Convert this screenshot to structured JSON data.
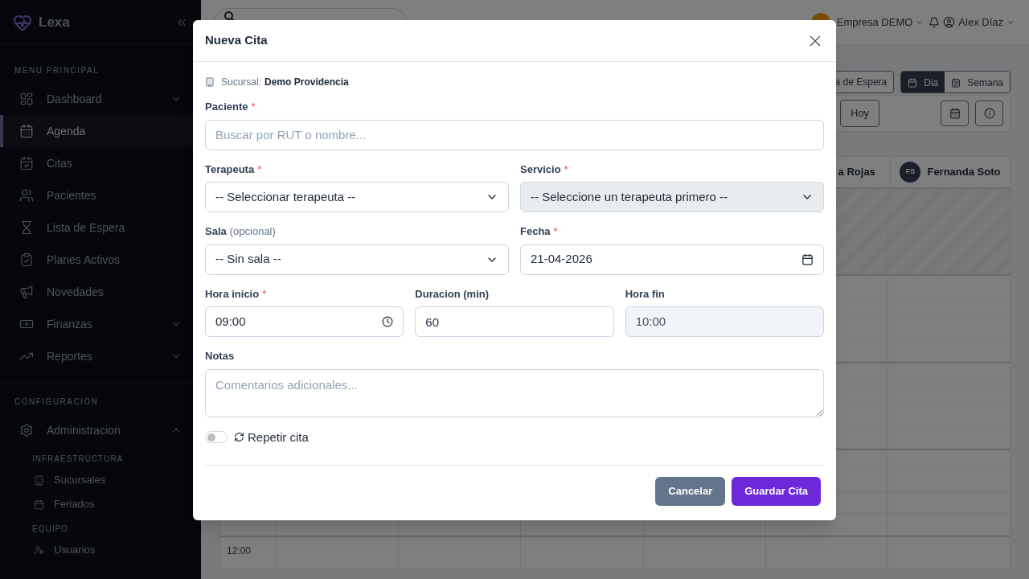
{
  "sidebar": {
    "brand": "Lexa",
    "sections": [
      {
        "title": "MENU PRINCIPAL",
        "items": [
          {
            "label": "Dashboard",
            "selected": false,
            "expanded": false
          },
          {
            "label": "Agenda",
            "selected": true
          },
          {
            "label": "Citas",
            "selected": false
          },
          {
            "label": "Pacientes",
            "selected": false
          },
          {
            "label": "Lista de Espera",
            "selected": false
          },
          {
            "label": "Planes Activos",
            "selected": false
          },
          {
            "label": "Novedades",
            "selected": false
          },
          {
            "label": "Finanzas",
            "selected": false,
            "expanded": false
          },
          {
            "label": "Reportes",
            "selected": false,
            "expanded": false
          }
        ]
      },
      {
        "title": "CONFIGURACION",
        "items": [
          {
            "label": "Administracion",
            "selected": false,
            "expanded": true,
            "children": [
              {
                "title": "INFRAESTRUCTURA",
                "items": [
                  {
                    "label": "Sucursales",
                    "selected": false
                  },
                  {
                    "label": "Feriados",
                    "selected": false
                  }
                ]
              },
              {
                "title": "EQUIPO",
                "items": [
                  {
                    "label": "Usuarios",
                    "selected": false
                  }
                ]
              }
            ]
          }
        ]
      }
    ]
  },
  "topbar": {
    "company": "Empresa DEMO",
    "user": "Alex Díaz"
  },
  "toolbar": {
    "waitlist_button": "a de Espera",
    "views": [
      {
        "label": "Dia",
        "selected": true
      },
      {
        "label": "Semana",
        "selected": false
      }
    ],
    "today_button": "Hoy"
  },
  "calendar": {
    "therapists": [
      {
        "name": "a Rojas"
      },
      {
        "initials": "FS",
        "name": "Fernanda Soto"
      }
    ],
    "time_labels": [
      "12:00"
    ]
  },
  "modal": {
    "title": "Nueva Cita",
    "branch": {
      "label": "Sucursal:",
      "value": "Demo Providencia"
    },
    "rows": [
      [
        {
          "label": "Paciente",
          "required_mark": "*",
          "kind": "text",
          "placeholder": "Buscar por RUT o nombre..."
        }
      ],
      [
        {
          "label": "Terapeuta",
          "required_mark": "*",
          "kind": "select",
          "value": "-- Seleccionar terapeuta --",
          "disabled": false
        },
        {
          "label": "Servicio",
          "required_mark": "*",
          "kind": "select",
          "value": "-- Seleccione un terapeuta primero --",
          "disabled": true
        }
      ],
      [
        {
          "label": "Sala",
          "hint": "(opcional)",
          "kind": "select",
          "value": "-- Sin sala --",
          "disabled": false
        },
        {
          "label": "Fecha",
          "required_mark": "*",
          "kind": "date",
          "value": "21-04-2026"
        }
      ],
      [
        {
          "label": "Hora inicio",
          "required_mark": "*",
          "kind": "time",
          "value": "09:00"
        },
        {
          "label": "Duracion (min)",
          "kind": "text",
          "value": "60"
        },
        {
          "label": "Hora fin",
          "kind": "readonly",
          "value": "10:00"
        }
      ],
      [
        {
          "label": "Notas",
          "kind": "textarea",
          "placeholder": "Comentarios adicionales..."
        }
      ]
    ],
    "toggle": {
      "label": "Repetir cita",
      "on": false
    },
    "buttons": [
      {
        "label": "Cancelar",
        "kind": "secondary"
      },
      {
        "label": "Guardar Cita",
        "kind": "primary"
      }
    ]
  }
}
